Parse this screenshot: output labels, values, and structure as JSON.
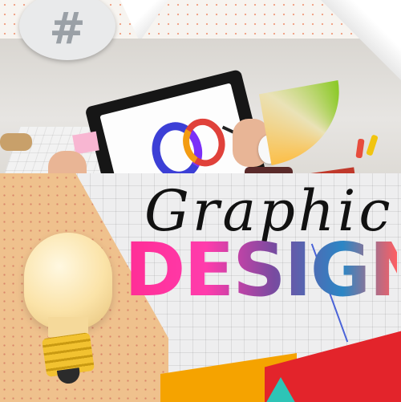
{
  "title": {
    "script": "Graphic",
    "bold": "DESIGN"
  },
  "badge": {
    "symbol": "#",
    "icon": "hashtag-icon"
  },
  "colors": {
    "accent_pink": "#ff2d95",
    "accent_blue": "#2b86c5",
    "accent_red": "#e3242b",
    "accent_orange": "#f5a300",
    "bulb_base": "#f2c230"
  }
}
